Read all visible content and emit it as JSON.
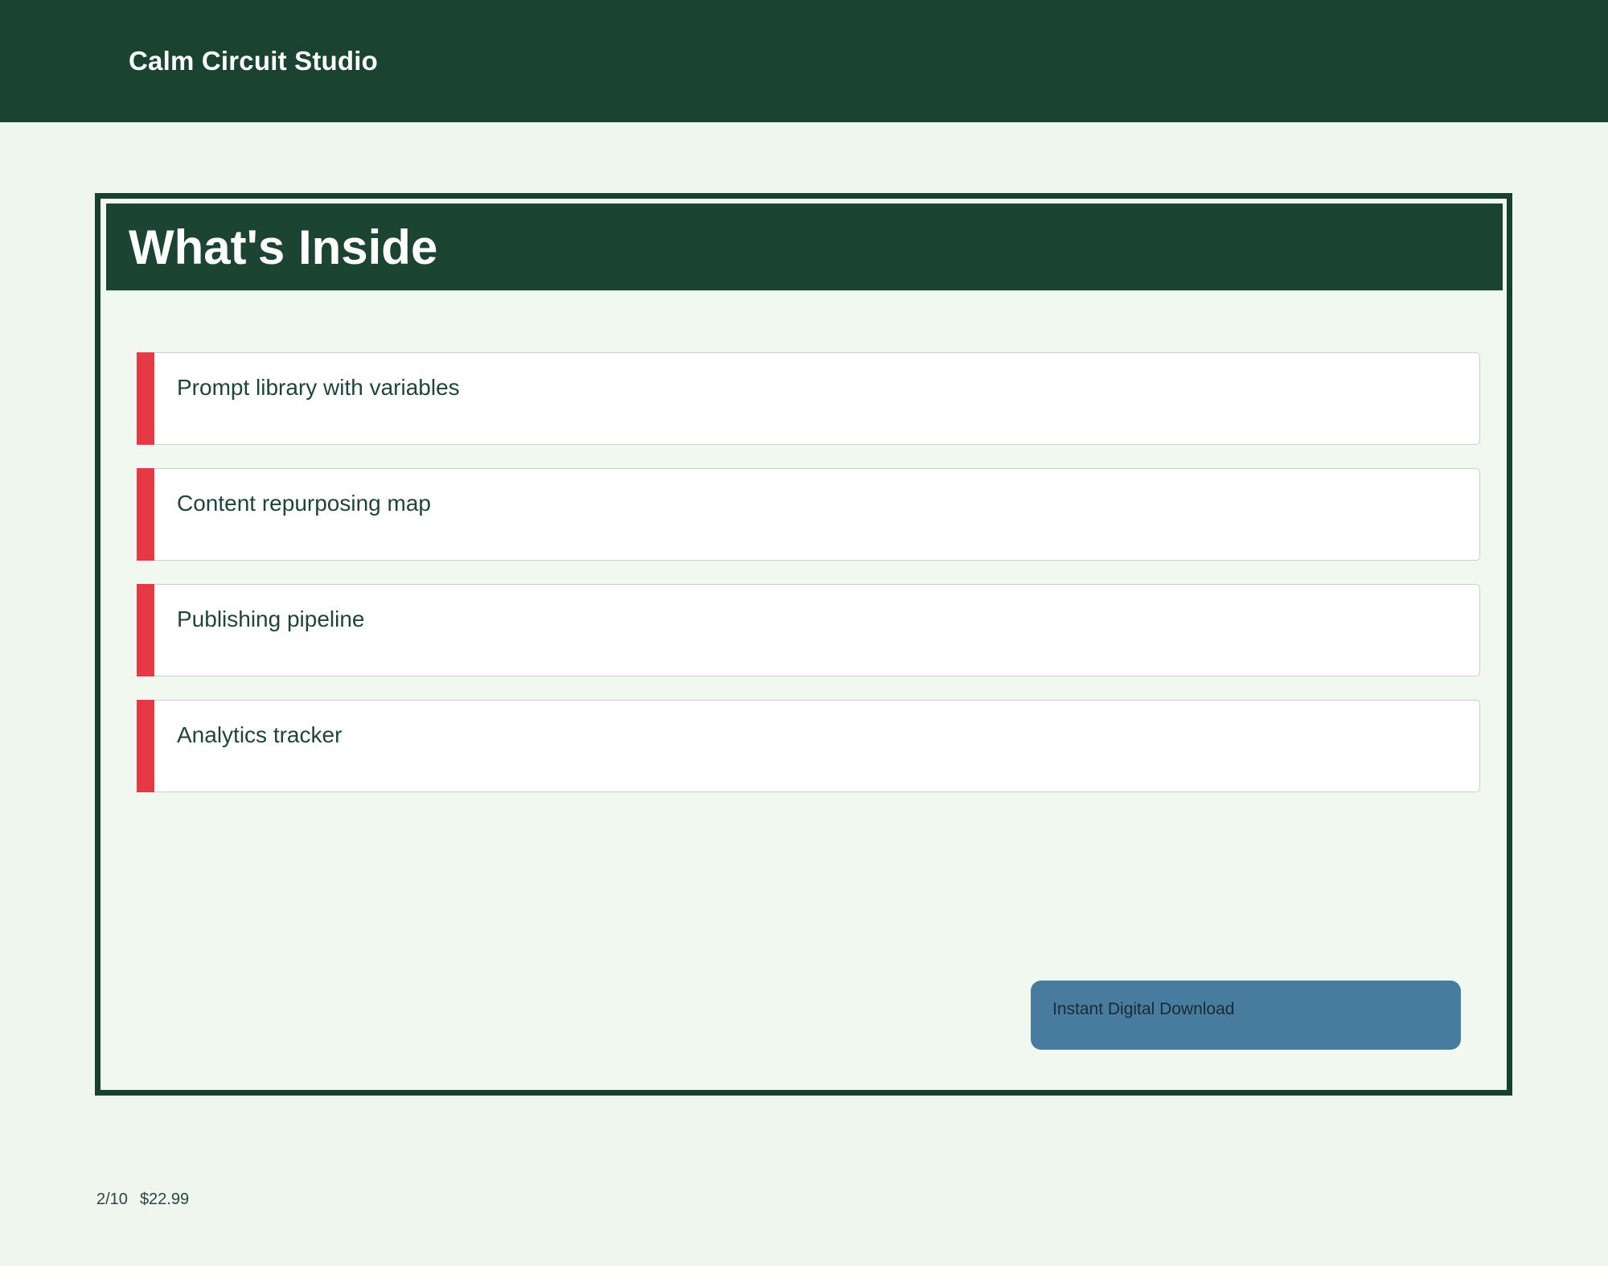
{
  "brand": {
    "name": "Calm Circuit Studio"
  },
  "card": {
    "title": "What's Inside",
    "items": [
      "Prompt library with variables",
      "Content repurposing map",
      "Publishing pipeline",
      "Analytics tracker"
    ],
    "badge_label": "Instant Digital Download"
  },
  "footer": {
    "page_indicator": "2/10",
    "price": "$22.99"
  },
  "colors": {
    "dark_green": "#1b4332",
    "page_background": "#eef6ee",
    "card_background": "#f0f8f0",
    "accent_red": "#e63946",
    "badge_blue": "#477c9e",
    "item_text_green": "#1d4638",
    "white": "#ffffff"
  }
}
